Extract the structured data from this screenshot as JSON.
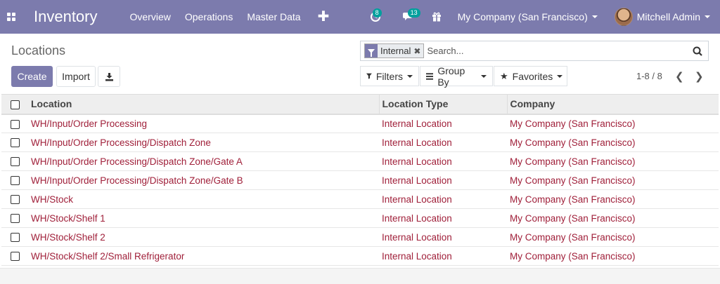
{
  "navbar": {
    "app_title": "Inventory",
    "menu": [
      "Overview",
      "Operations",
      "Master Data"
    ],
    "plus_icon": "plus-icon",
    "activity_badge": "8",
    "messages_badge": "13",
    "company": "My Company (San Francisco)",
    "user": "Mitchell Admin",
    "accent_color": "#7c7bad"
  },
  "control": {
    "title": "Locations",
    "create_label": "Create",
    "import_label": "Import",
    "facet_label": "Internal",
    "search_placeholder": "Search...",
    "filters_label": "Filters",
    "groupby_label": "Group By",
    "favorites_label": "Favorites",
    "pager": "1-8 / 8"
  },
  "table": {
    "headers": [
      "Location",
      "Location Type",
      "Company"
    ],
    "rows": [
      [
        "WH/Input/Order Processing",
        "Internal Location",
        "My Company (San Francisco)"
      ],
      [
        "WH/Input/Order Processing/Dispatch Zone",
        "Internal Location",
        "My Company (San Francisco)"
      ],
      [
        "WH/Input/Order Processing/Dispatch Zone/Gate A",
        "Internal Location",
        "My Company (San Francisco)"
      ],
      [
        "WH/Input/Order Processing/Dispatch Zone/Gate B",
        "Internal Location",
        "My Company (San Francisco)"
      ],
      [
        "WH/Stock",
        "Internal Location",
        "My Company (San Francisco)"
      ],
      [
        "WH/Stock/Shelf 1",
        "Internal Location",
        "My Company (San Francisco)"
      ],
      [
        "WH/Stock/Shelf 2",
        "Internal Location",
        "My Company (San Francisco)"
      ],
      [
        "WH/Stock/Shelf 2/Small Refrigerator",
        "Internal Location",
        "My Company (San Francisco)"
      ]
    ],
    "link_color": "#a0203a"
  }
}
